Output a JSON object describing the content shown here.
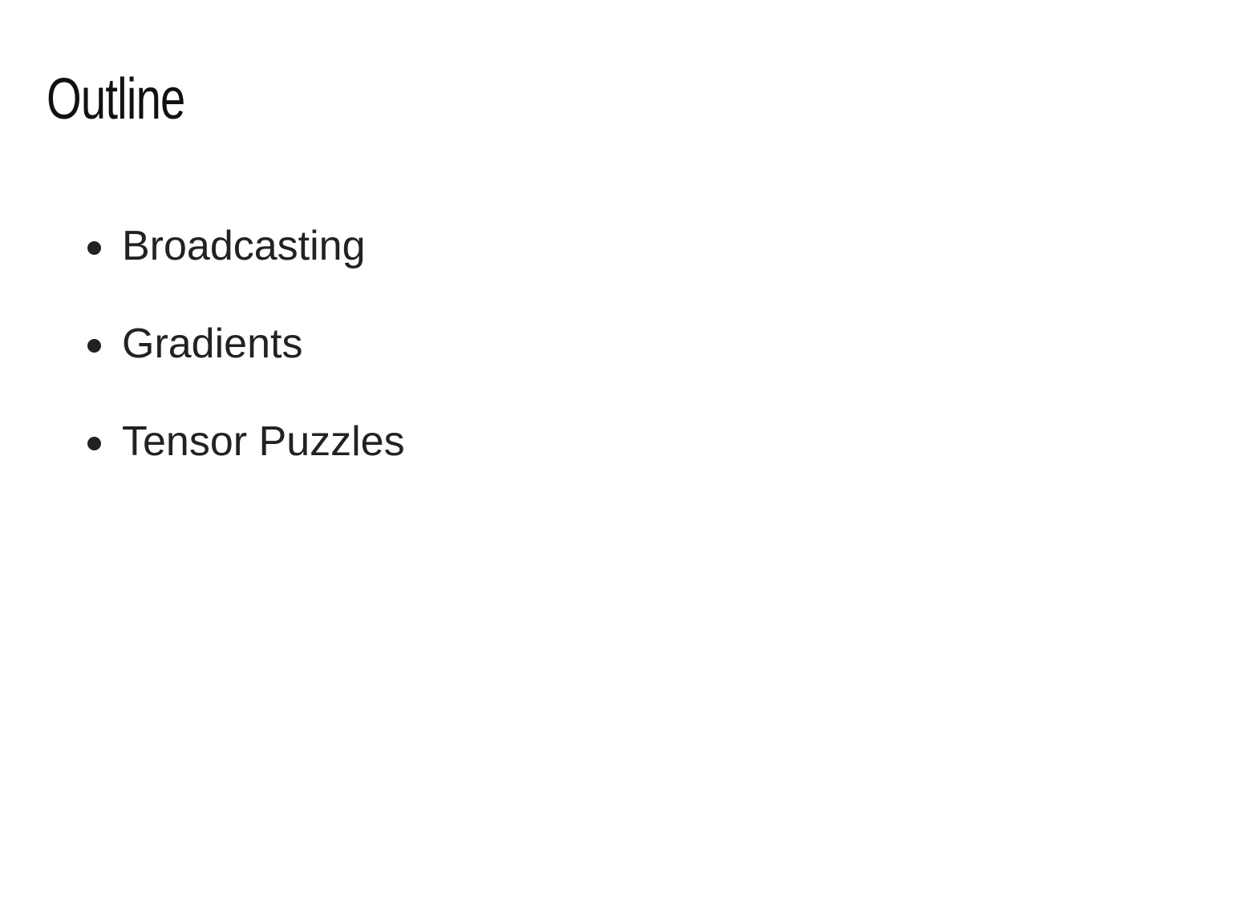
{
  "slide": {
    "title": "Outline",
    "items": [
      {
        "label": "Broadcasting"
      },
      {
        "label": "Gradients"
      },
      {
        "label": "Tensor Puzzles"
      }
    ]
  }
}
